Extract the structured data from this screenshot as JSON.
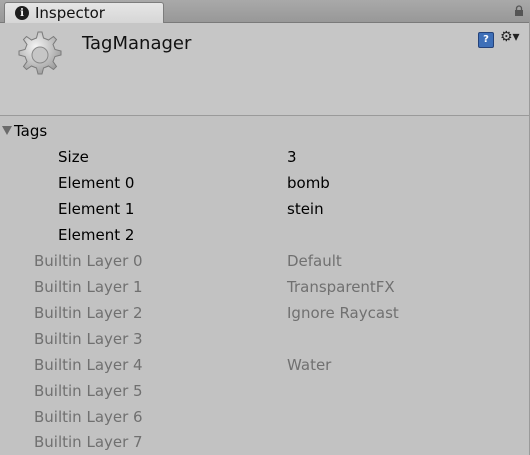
{
  "tab": {
    "icon": "info-icon",
    "icon_glyph": "i",
    "label": "Inspector",
    "lock_icon": "lock-icon"
  },
  "header": {
    "icon": "gear-icon",
    "title": "TagManager",
    "help_icon": "help-icon",
    "help_glyph": "?",
    "settings_icon": "gear-settings-icon",
    "settings_glyph": "⚙▾"
  },
  "tags": {
    "label": "Tags",
    "size_label": "Size",
    "size_value": "3",
    "elements": [
      {
        "label": "Element 0",
        "value": "bomb"
      },
      {
        "label": "Element 1",
        "value": "stein"
      },
      {
        "label": "Element 2",
        "value": ""
      }
    ]
  },
  "layers": [
    {
      "label": "Builtin Layer 0",
      "value": "Default"
    },
    {
      "label": "Builtin Layer 1",
      "value": "TransparentFX"
    },
    {
      "label": "Builtin Layer 2",
      "value": "Ignore Raycast"
    },
    {
      "label": "Builtin Layer 3",
      "value": ""
    },
    {
      "label": "Builtin Layer 4",
      "value": "Water"
    },
    {
      "label": "Builtin Layer 5",
      "value": ""
    },
    {
      "label": "Builtin Layer 6",
      "value": ""
    },
    {
      "label": "Builtin Layer 7",
      "value": ""
    }
  ]
}
